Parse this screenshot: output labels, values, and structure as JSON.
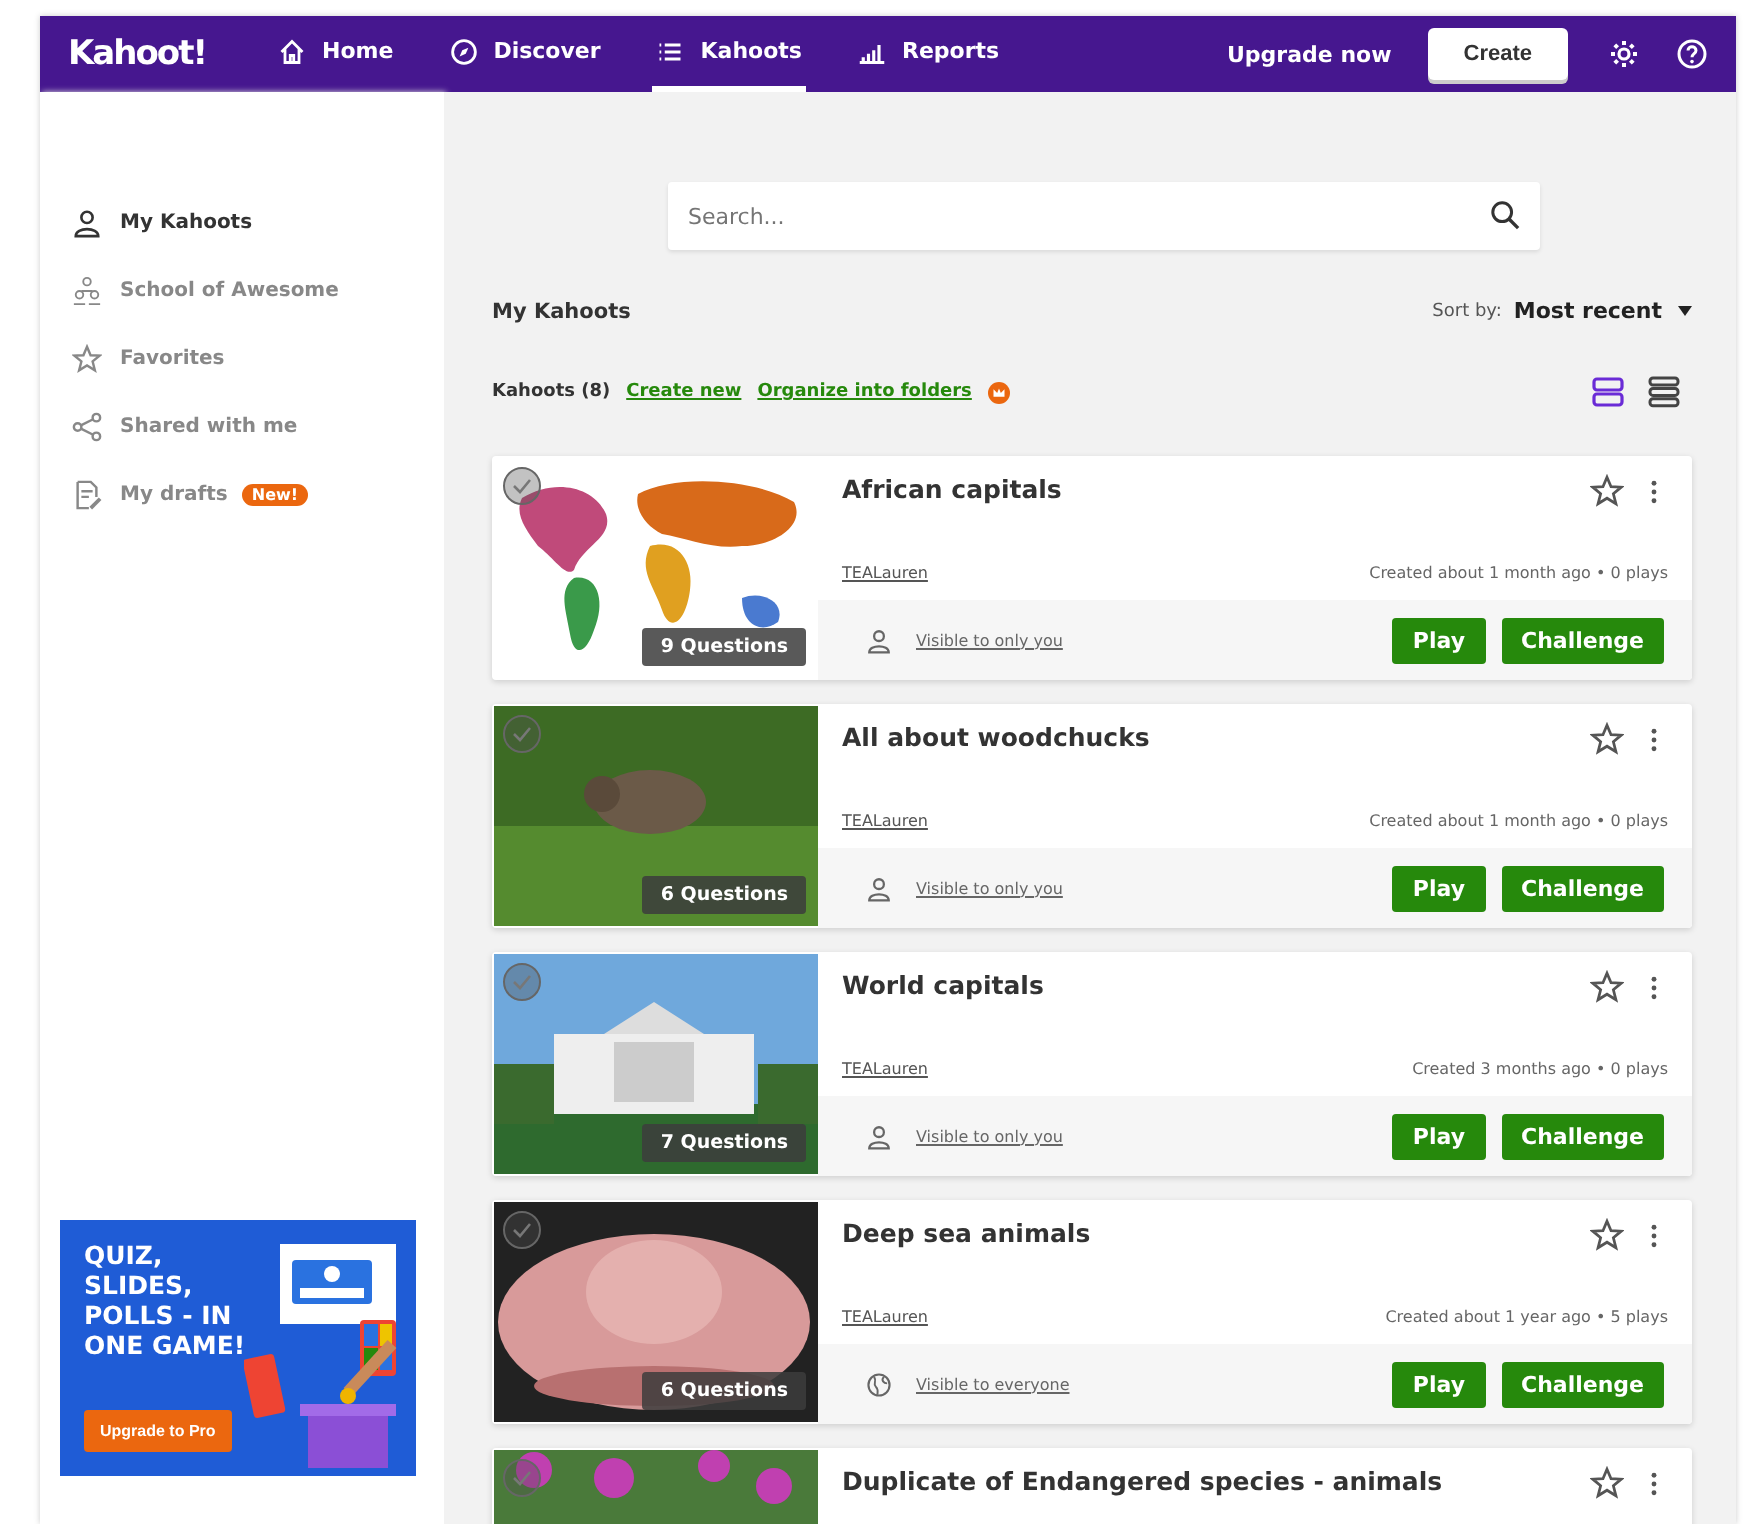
{
  "topbar": {
    "logo": "Kahoot!",
    "nav": [
      {
        "label": "Home",
        "selected": false
      },
      {
        "label": "Discover",
        "selected": false
      },
      {
        "label": "Kahoots",
        "selected": true
      },
      {
        "label": "Reports",
        "selected": false
      }
    ],
    "upgrade": "Upgrade now",
    "create": "Create"
  },
  "sidebar": {
    "items": [
      {
        "label": "My Kahoots",
        "selected": true
      },
      {
        "label": "School of Awesome",
        "selected": false
      },
      {
        "label": "Favorites",
        "selected": false
      },
      {
        "label": "Shared with me",
        "selected": false
      },
      {
        "label": "My drafts",
        "selected": false,
        "badge": "New!"
      }
    ],
    "promo": {
      "headline": [
        "QUIZ,",
        "SLIDES,",
        "POLLS - IN",
        "ONE GAME!"
      ],
      "button": "Upgrade to Pro"
    }
  },
  "search": {
    "placeholder": "Search..."
  },
  "heading": "My Kahoots",
  "sort": {
    "label": "Sort by:",
    "value": "Most recent"
  },
  "toolbar": {
    "count": "Kahoots (8)",
    "links": [
      "Create new",
      "Organize into folders"
    ]
  },
  "view_toggle": [
    {
      "selected": true
    },
    {
      "selected": false
    }
  ],
  "kahoots": [
    {
      "title": "African capitals",
      "questions": "9 Questions",
      "author": "TEALauren",
      "meta": "Created about 1 month ago • 0 plays",
      "visibility": "Visible to only you",
      "kind": "private",
      "actions": [
        "Play",
        "Challenge"
      ]
    },
    {
      "title": "All about woodchucks",
      "questions": "6 Questions",
      "author": "TEALauren",
      "meta": "Created about 1 month ago • 0 plays",
      "visibility": "Visible to only you",
      "kind": "private",
      "actions": [
        "Play",
        "Challenge"
      ]
    },
    {
      "title": "World capitals",
      "questions": "7 Questions",
      "author": "TEALauren",
      "meta": "Created 3 months ago • 0 plays",
      "visibility": "Visible to only you",
      "kind": "private",
      "actions": [
        "Play",
        "Challenge"
      ]
    },
    {
      "title": "Deep sea animals",
      "questions": "6 Questions",
      "author": "TEALauren",
      "meta": "Created about 1 year ago • 5 plays",
      "visibility": "Visible to everyone",
      "kind": "public",
      "actions": [
        "Play",
        "Challenge"
      ]
    },
    {
      "title": "Duplicate of Endangered species - animals"
    }
  ]
}
